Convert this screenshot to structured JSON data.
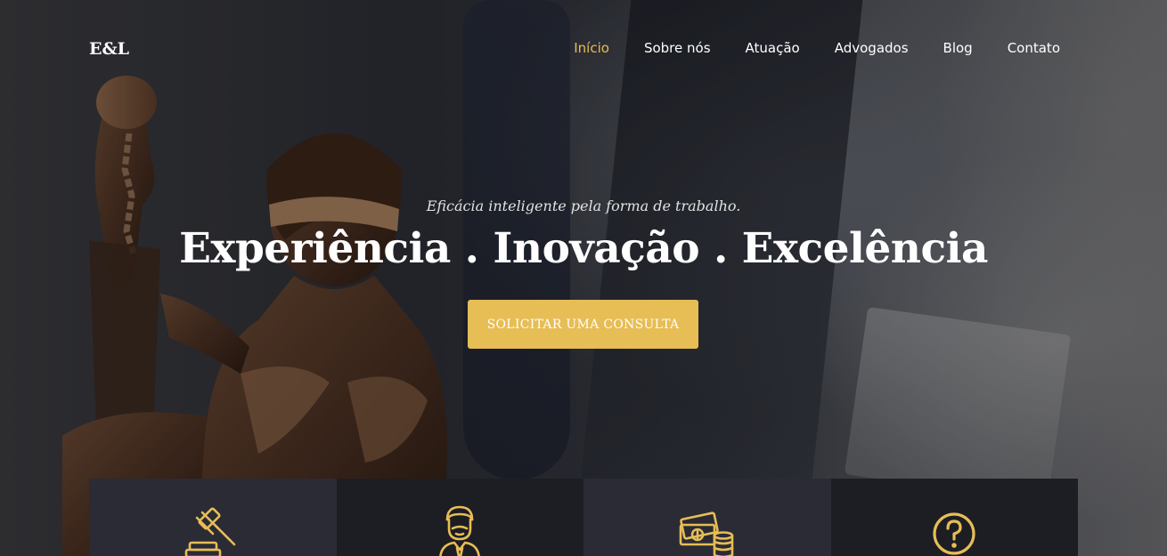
{
  "brand": {
    "logo": "E&L"
  },
  "nav": {
    "items": [
      {
        "label": "Início",
        "active": true
      },
      {
        "label": "Sobre nós",
        "active": false
      },
      {
        "label": "Atuação",
        "active": false
      },
      {
        "label": "Advogados",
        "active": false
      },
      {
        "label": "Blog",
        "active": false
      },
      {
        "label": "Contato",
        "active": false
      }
    ]
  },
  "hero": {
    "tagline": "Eficácia inteligente pela forma de trabalho.",
    "headline": "Experiência . Inovação . Excelência",
    "cta_label": "SOLICITAR UMA CONSULTA"
  },
  "features": [
    {
      "icon": "gavel-icon"
    },
    {
      "icon": "lawyer-icon"
    },
    {
      "icon": "money-icon"
    },
    {
      "icon": "question-icon"
    }
  ],
  "colors": {
    "accent": "#e7bd55",
    "feature_light": "#2a2b35",
    "feature_dark": "#1d1e24"
  }
}
